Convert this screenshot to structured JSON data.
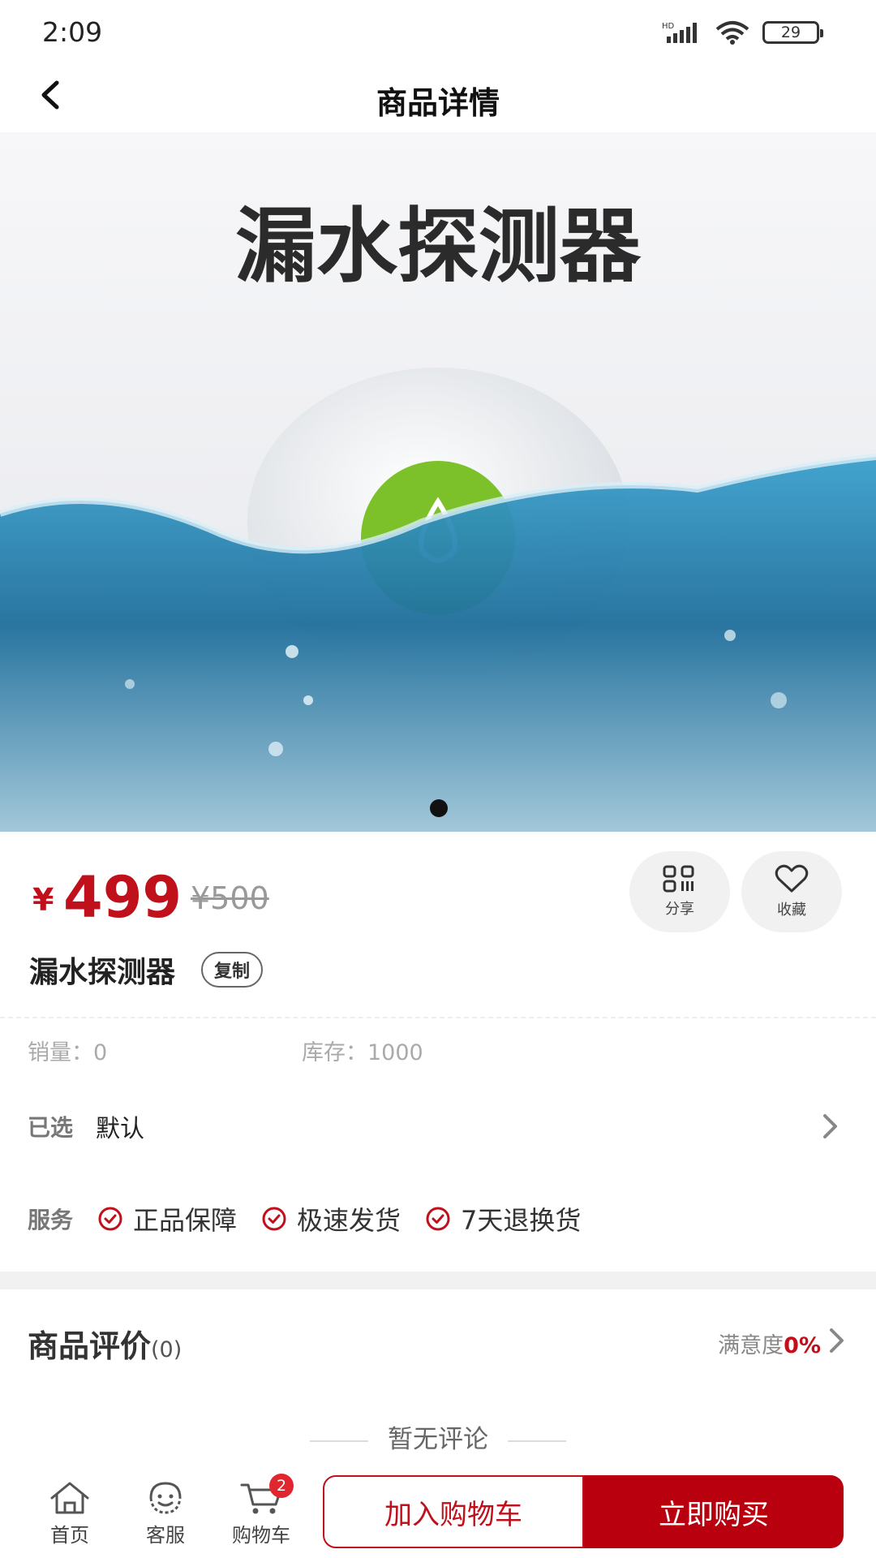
{
  "status_bar": {
    "time": "2:09",
    "battery": "29",
    "network": "HD"
  },
  "nav": {
    "title": "商品详情"
  },
  "hero": {
    "banner_title": "漏水探测器",
    "carousel_index": 1,
    "carousel_total": 1
  },
  "price": {
    "currency": "¥",
    "current": "499",
    "original": "¥500"
  },
  "actions": {
    "share_label": "分享",
    "favorite_label": "收藏"
  },
  "product": {
    "name": "漏水探测器",
    "copy_label": "复制"
  },
  "stats": {
    "sales": "销量：0",
    "stock": "库存：1000"
  },
  "selection": {
    "label": "已选",
    "value": "默认"
  },
  "services": {
    "label": "服务",
    "items": [
      "正品保障",
      "极速发货",
      "7天退换货"
    ]
  },
  "reviews": {
    "title": "商品评价",
    "count": "(0)",
    "satisfaction_label": "满意度",
    "satisfaction_value": "0%",
    "empty_text": "暂无评论"
  },
  "bottom": {
    "home_label": "首页",
    "service_label": "客服",
    "cart_label": "购物车",
    "cart_count": "2",
    "add_cart_label": "加入购物车",
    "buy_now_label": "立即购买"
  },
  "colors": {
    "accent": "#c0101b",
    "buy_bg": "#b8000e",
    "badge": "#e0262e"
  }
}
